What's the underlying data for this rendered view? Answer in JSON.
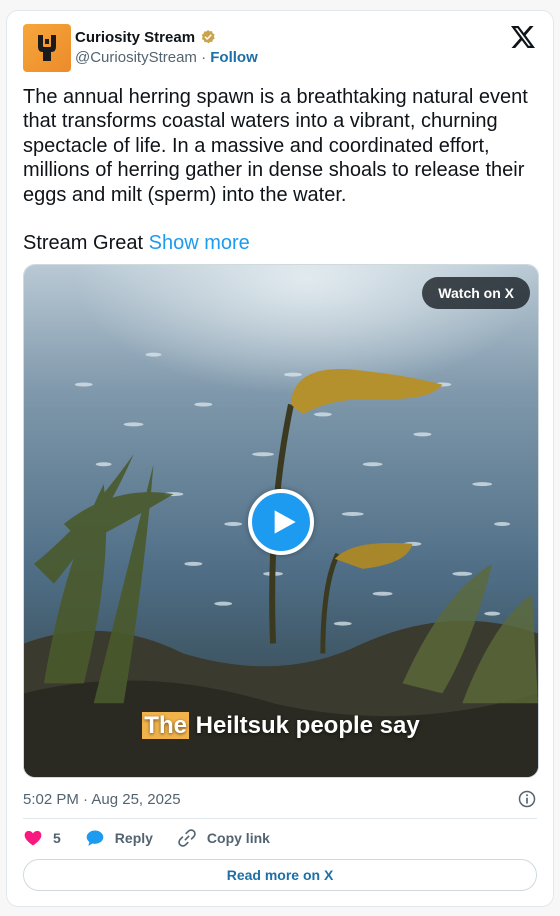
{
  "author": {
    "name": "Curiosity Stream",
    "handle": "@CuriosityStream",
    "separator": " · ",
    "follow_label": "Follow",
    "avatar_bg": "#f09a35"
  },
  "post": {
    "text": "The annual herring spawn is a breathtaking natural event that transforms coastal waters into a vibrant, churning spectacle of life. In a massive and coordinated effort, millions of herring gather in dense shoals to release their eggs and milt (sperm) into the water.",
    "text2": "Stream Great ",
    "show_more_label": "Show more"
  },
  "media": {
    "watch_label": "Watch on X",
    "caption_highlight": "The",
    "caption_rest": " Heiltsuk people say"
  },
  "meta": {
    "timestamp": "5:02 PM · Aug 25, 2025"
  },
  "actions": {
    "like_count": "5",
    "reply_label": "Reply",
    "copy_link_label": "Copy link",
    "read_more_label": "Read more on X"
  },
  "colors": {
    "link": "#1d9bf0",
    "like": "#f91880",
    "follow": "#1d6fa5"
  },
  "icons": [
    "verified-badge-icon",
    "x-logo-icon",
    "play-icon",
    "info-icon",
    "heart-icon",
    "reply-icon",
    "link-icon"
  ]
}
